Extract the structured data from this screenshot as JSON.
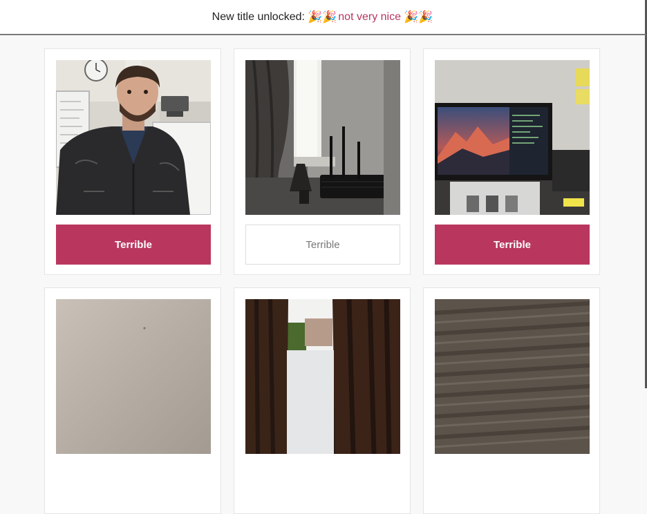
{
  "header": {
    "prefix": "New title unlocked:",
    "party_left": "🎉🎉",
    "title_value": "not very nice",
    "party_right": "🎉🎉"
  },
  "cards": [
    {
      "photo_icon": "person-selfie-photo",
      "vote_label": "Terrible",
      "selected": true
    },
    {
      "photo_icon": "router-window-photo",
      "vote_label": "Terrible",
      "selected": false
    },
    {
      "photo_icon": "monitor-desk-photo",
      "vote_label": "Terrible",
      "selected": true
    },
    {
      "photo_icon": "wall-photo"
    },
    {
      "photo_icon": "curtain-window-photo"
    },
    {
      "photo_icon": "carpet-photo"
    }
  ],
  "colors": {
    "accent": "#b9375f",
    "title_text": "#b9365f",
    "background": "#f8f8f8"
  }
}
